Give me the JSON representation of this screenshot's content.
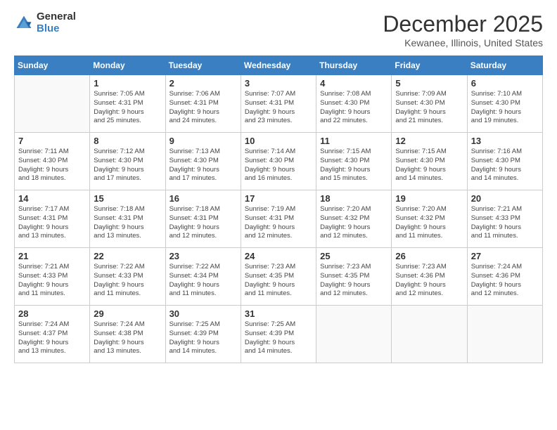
{
  "logo": {
    "general": "General",
    "blue": "Blue"
  },
  "title": "December 2025",
  "location": "Kewanee, Illinois, United States",
  "headers": [
    "Sunday",
    "Monday",
    "Tuesday",
    "Wednesday",
    "Thursday",
    "Friday",
    "Saturday"
  ],
  "weeks": [
    [
      {
        "day": "",
        "lines": []
      },
      {
        "day": "1",
        "lines": [
          "Sunrise: 7:05 AM",
          "Sunset: 4:31 PM",
          "Daylight: 9 hours",
          "and 25 minutes."
        ]
      },
      {
        "day": "2",
        "lines": [
          "Sunrise: 7:06 AM",
          "Sunset: 4:31 PM",
          "Daylight: 9 hours",
          "and 24 minutes."
        ]
      },
      {
        "day": "3",
        "lines": [
          "Sunrise: 7:07 AM",
          "Sunset: 4:31 PM",
          "Daylight: 9 hours",
          "and 23 minutes."
        ]
      },
      {
        "day": "4",
        "lines": [
          "Sunrise: 7:08 AM",
          "Sunset: 4:30 PM",
          "Daylight: 9 hours",
          "and 22 minutes."
        ]
      },
      {
        "day": "5",
        "lines": [
          "Sunrise: 7:09 AM",
          "Sunset: 4:30 PM",
          "Daylight: 9 hours",
          "and 21 minutes."
        ]
      },
      {
        "day": "6",
        "lines": [
          "Sunrise: 7:10 AM",
          "Sunset: 4:30 PM",
          "Daylight: 9 hours",
          "and 19 minutes."
        ]
      }
    ],
    [
      {
        "day": "7",
        "lines": [
          "Sunrise: 7:11 AM",
          "Sunset: 4:30 PM",
          "Daylight: 9 hours",
          "and 18 minutes."
        ]
      },
      {
        "day": "8",
        "lines": [
          "Sunrise: 7:12 AM",
          "Sunset: 4:30 PM",
          "Daylight: 9 hours",
          "and 17 minutes."
        ]
      },
      {
        "day": "9",
        "lines": [
          "Sunrise: 7:13 AM",
          "Sunset: 4:30 PM",
          "Daylight: 9 hours",
          "and 17 minutes."
        ]
      },
      {
        "day": "10",
        "lines": [
          "Sunrise: 7:14 AM",
          "Sunset: 4:30 PM",
          "Daylight: 9 hours",
          "and 16 minutes."
        ]
      },
      {
        "day": "11",
        "lines": [
          "Sunrise: 7:15 AM",
          "Sunset: 4:30 PM",
          "Daylight: 9 hours",
          "and 15 minutes."
        ]
      },
      {
        "day": "12",
        "lines": [
          "Sunrise: 7:15 AM",
          "Sunset: 4:30 PM",
          "Daylight: 9 hours",
          "and 14 minutes."
        ]
      },
      {
        "day": "13",
        "lines": [
          "Sunrise: 7:16 AM",
          "Sunset: 4:30 PM",
          "Daylight: 9 hours",
          "and 14 minutes."
        ]
      }
    ],
    [
      {
        "day": "14",
        "lines": [
          "Sunrise: 7:17 AM",
          "Sunset: 4:31 PM",
          "Daylight: 9 hours",
          "and 13 minutes."
        ]
      },
      {
        "day": "15",
        "lines": [
          "Sunrise: 7:18 AM",
          "Sunset: 4:31 PM",
          "Daylight: 9 hours",
          "and 13 minutes."
        ]
      },
      {
        "day": "16",
        "lines": [
          "Sunrise: 7:18 AM",
          "Sunset: 4:31 PM",
          "Daylight: 9 hours",
          "and 12 minutes."
        ]
      },
      {
        "day": "17",
        "lines": [
          "Sunrise: 7:19 AM",
          "Sunset: 4:31 PM",
          "Daylight: 9 hours",
          "and 12 minutes."
        ]
      },
      {
        "day": "18",
        "lines": [
          "Sunrise: 7:20 AM",
          "Sunset: 4:32 PM",
          "Daylight: 9 hours",
          "and 12 minutes."
        ]
      },
      {
        "day": "19",
        "lines": [
          "Sunrise: 7:20 AM",
          "Sunset: 4:32 PM",
          "Daylight: 9 hours",
          "and 11 minutes."
        ]
      },
      {
        "day": "20",
        "lines": [
          "Sunrise: 7:21 AM",
          "Sunset: 4:33 PM",
          "Daylight: 9 hours",
          "and 11 minutes."
        ]
      }
    ],
    [
      {
        "day": "21",
        "lines": [
          "Sunrise: 7:21 AM",
          "Sunset: 4:33 PM",
          "Daylight: 9 hours",
          "and 11 minutes."
        ]
      },
      {
        "day": "22",
        "lines": [
          "Sunrise: 7:22 AM",
          "Sunset: 4:33 PM",
          "Daylight: 9 hours",
          "and 11 minutes."
        ]
      },
      {
        "day": "23",
        "lines": [
          "Sunrise: 7:22 AM",
          "Sunset: 4:34 PM",
          "Daylight: 9 hours",
          "and 11 minutes."
        ]
      },
      {
        "day": "24",
        "lines": [
          "Sunrise: 7:23 AM",
          "Sunset: 4:35 PM",
          "Daylight: 9 hours",
          "and 11 minutes."
        ]
      },
      {
        "day": "25",
        "lines": [
          "Sunrise: 7:23 AM",
          "Sunset: 4:35 PM",
          "Daylight: 9 hours",
          "and 12 minutes."
        ]
      },
      {
        "day": "26",
        "lines": [
          "Sunrise: 7:23 AM",
          "Sunset: 4:36 PM",
          "Daylight: 9 hours",
          "and 12 minutes."
        ]
      },
      {
        "day": "27",
        "lines": [
          "Sunrise: 7:24 AM",
          "Sunset: 4:36 PM",
          "Daylight: 9 hours",
          "and 12 minutes."
        ]
      }
    ],
    [
      {
        "day": "28",
        "lines": [
          "Sunrise: 7:24 AM",
          "Sunset: 4:37 PM",
          "Daylight: 9 hours",
          "and 13 minutes."
        ]
      },
      {
        "day": "29",
        "lines": [
          "Sunrise: 7:24 AM",
          "Sunset: 4:38 PM",
          "Daylight: 9 hours",
          "and 13 minutes."
        ]
      },
      {
        "day": "30",
        "lines": [
          "Sunrise: 7:25 AM",
          "Sunset: 4:39 PM",
          "Daylight: 9 hours",
          "and 14 minutes."
        ]
      },
      {
        "day": "31",
        "lines": [
          "Sunrise: 7:25 AM",
          "Sunset: 4:39 PM",
          "Daylight: 9 hours",
          "and 14 minutes."
        ]
      },
      {
        "day": "",
        "lines": []
      },
      {
        "day": "",
        "lines": []
      },
      {
        "day": "",
        "lines": []
      }
    ]
  ]
}
